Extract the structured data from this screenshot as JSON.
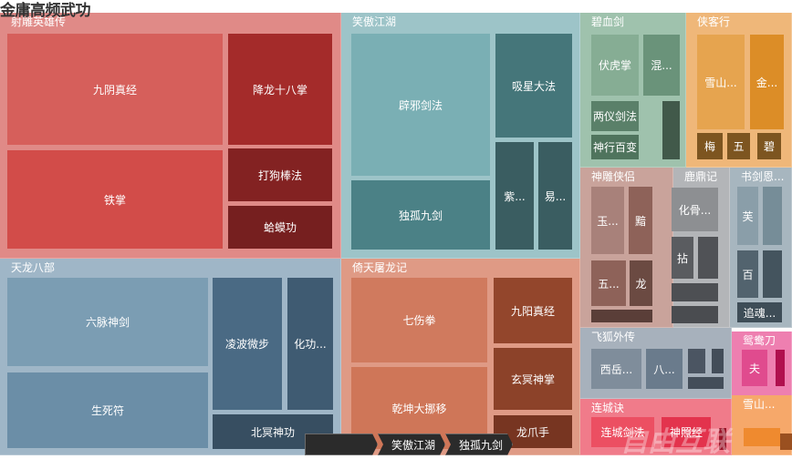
{
  "chart_data": {
    "type": "treemap",
    "title": "金庸高频武功",
    "groups": [
      {
        "name": "射雕英雄传",
        "color": "#e08a87",
        "children": [
          {
            "name": "九阴真经",
            "label": "九阴真经",
            "color": "#d65f5b"
          },
          {
            "name": "铁掌",
            "label": "铁掌",
            "color": "#d24c49"
          },
          {
            "name": "降龙十八掌",
            "label": "降龙十八掌",
            "color": "#a42b2a"
          },
          {
            "name": "打狗棒法",
            "label": "打狗棒法",
            "color": "#832222"
          },
          {
            "name": "蛤蟆功",
            "label": "蛤蟆功",
            "color": "#761f1f"
          }
        ]
      },
      {
        "name": "笑傲江湖",
        "color": "#9dc4c8",
        "children": [
          {
            "name": "辟邪剑法",
            "label": "辟邪剑法",
            "color": "#7aafb4"
          },
          {
            "name": "独孤九剑",
            "label": "独孤九剑",
            "color": "#4b8186"
          },
          {
            "name": "吸星大法",
            "label": "吸星大法",
            "color": "#45767a"
          },
          {
            "name": "紫霞神功",
            "label": "紫...",
            "color": "#3a5d61"
          },
          {
            "name": "易筋经",
            "label": "易...",
            "color": "#3a5d61"
          }
        ]
      },
      {
        "name": "天龙八部",
        "color": "#9fb6c7",
        "children": [
          {
            "name": "六脉神剑",
            "label": "六脉神剑",
            "color": "#7b9db3"
          },
          {
            "name": "生死符",
            "label": "生死符",
            "color": "#6b8ea7"
          },
          {
            "name": "凌波微步",
            "label": "凌波微步",
            "color": "#4a6a84"
          },
          {
            "name": "化功大法",
            "label": "化功...",
            "color": "#3f5b72"
          },
          {
            "name": "北冥神功",
            "label": "北冥神功",
            "color": "#374e61"
          }
        ]
      },
      {
        "name": "倚天屠龙记",
        "color": "#df9a85",
        "children": [
          {
            "name": "七伤拳",
            "label": "七伤拳",
            "color": "#d07a5e"
          },
          {
            "name": "乾坤大挪移",
            "label": "乾坤大挪移",
            "color": "#cf7658"
          },
          {
            "name": "九阳真经",
            "label": "九阳真经",
            "color": "#93462c"
          },
          {
            "name": "玄冥神掌",
            "label": "玄冥神掌",
            "color": "#8c4229"
          },
          {
            "name": "龙爪手",
            "label": "龙爪手",
            "color": "#773521"
          }
        ]
      },
      {
        "name": "碧血剑",
        "color": "#9fc2ad",
        "children": [
          {
            "name": "伏虎掌",
            "label": "伏虎掌",
            "color": "#86ad94"
          },
          {
            "name": "混元功",
            "label": "混...",
            "color": "#6a937a"
          },
          {
            "name": "两仪剑法",
            "label": "两仪剑法",
            "color": "#5a8069"
          },
          {
            "name": "神行百变",
            "label": "神行百变",
            "color": "#4f745d"
          },
          {
            "name": "",
            "label": "",
            "color": "#41594a"
          }
        ]
      },
      {
        "name": "侠客行",
        "color": "#efb779",
        "children": [
          {
            "name": "雪山剑法",
            "label": "雪山...",
            "color": "#e6a44f"
          },
          {
            "name": "金乌刀法",
            "label": "金...",
            "color": "#dc8d27"
          },
          {
            "name": "梅",
            "label": "梅",
            "color": "#7d5520"
          },
          {
            "name": "五",
            "label": "五",
            "color": "#7d5520"
          },
          {
            "name": "碧",
            "label": "碧",
            "color": "#7d5520"
          }
        ]
      },
      {
        "name": "神雕侠侣",
        "color": "#c9a39b",
        "children": [
          {
            "name": "玉女心经",
            "label": "玉...",
            "color": "#a8817a"
          },
          {
            "name": "黯然销魂掌",
            "label": "黯",
            "color": "#8e6259"
          },
          {
            "name": "五",
            "label": "五...",
            "color": "#8e6259"
          },
          {
            "name": "龙",
            "label": "龙",
            "color": "#6b4a42"
          },
          {
            "name": "",
            "label": "",
            "color": "#5a3e38"
          }
        ]
      },
      {
        "name": "鹿鼎记",
        "color": "#b3b5b8",
        "children": [
          {
            "name": "化骨绵掌",
            "label": "化骨...",
            "color": "#8d8f92"
          },
          {
            "name": "拈花擒拿手",
            "label": "拈",
            "color": "#5a5c60"
          },
          {
            "name": "",
            "label": "",
            "color": "#505256"
          },
          {
            "name": "",
            "label": "",
            "color": "#4d4f53"
          },
          {
            "name": "",
            "label": "",
            "color": "#4a4c50"
          }
        ]
      },
      {
        "name": "书剑恩仇录",
        "label": "书剑恩...",
        "color": "#a7b6bf",
        "children": [
          {
            "name": "芙",
            "label": "芙",
            "color": "#8a9ea9"
          },
          {
            "name": "",
            "label": "",
            "color": "#768d98"
          },
          {
            "name": "百花错拳",
            "label": "百",
            "color": "#52636e"
          },
          {
            "name": "",
            "label": "",
            "color": "#44545e"
          },
          {
            "name": "追魂夺命剑",
            "label": "追魂...",
            "color": "#3e4d57"
          }
        ]
      },
      {
        "name": "飞狐外传",
        "color": "#a7b1bc",
        "children": [
          {
            "name": "西岳华拳",
            "label": "西岳...",
            "color": "#7f8d9b"
          },
          {
            "name": "八卦刀",
            "label": "八...",
            "color": "#6a7b8c"
          },
          {
            "name": "",
            "label": "",
            "color": "#4b5562"
          },
          {
            "name": "",
            "label": "",
            "color": "#434d59"
          },
          {
            "name": "",
            "label": "",
            "color": "#434d59"
          }
        ]
      },
      {
        "name": "鸳鸯刀",
        "color": "#ee7fb0",
        "children": [
          {
            "name": "夫",
            "label": "夫",
            "color": "#e04b8e"
          },
          {
            "name": "",
            "label": "",
            "color": "#b0104e"
          }
        ]
      },
      {
        "name": "连城诀",
        "color": "#f07b8a",
        "children": [
          {
            "name": "连城剑法",
            "label": "连城剑法",
            "color": "#ec4f62"
          },
          {
            "name": "神照经",
            "label": "神照经",
            "color": "#e3334d"
          },
          {
            "name": "",
            "label": "",
            "color": "#9a1428"
          }
        ]
      },
      {
        "name": "雪山飞狐",
        "label": "雪山...",
        "color": "#f6a86a",
        "children": [
          {
            "name": "",
            "label": "",
            "color": "#ef8a2f"
          },
          {
            "name": "",
            "label": "",
            "color": "#9a5020"
          },
          {
            "name": "",
            "label": "",
            "color": "#9a5020"
          }
        ]
      }
    ]
  },
  "breadcrumb": {
    "items": [
      "",
      "笑傲江湖",
      "独孤九剑"
    ]
  },
  "watermark": "自由互联"
}
